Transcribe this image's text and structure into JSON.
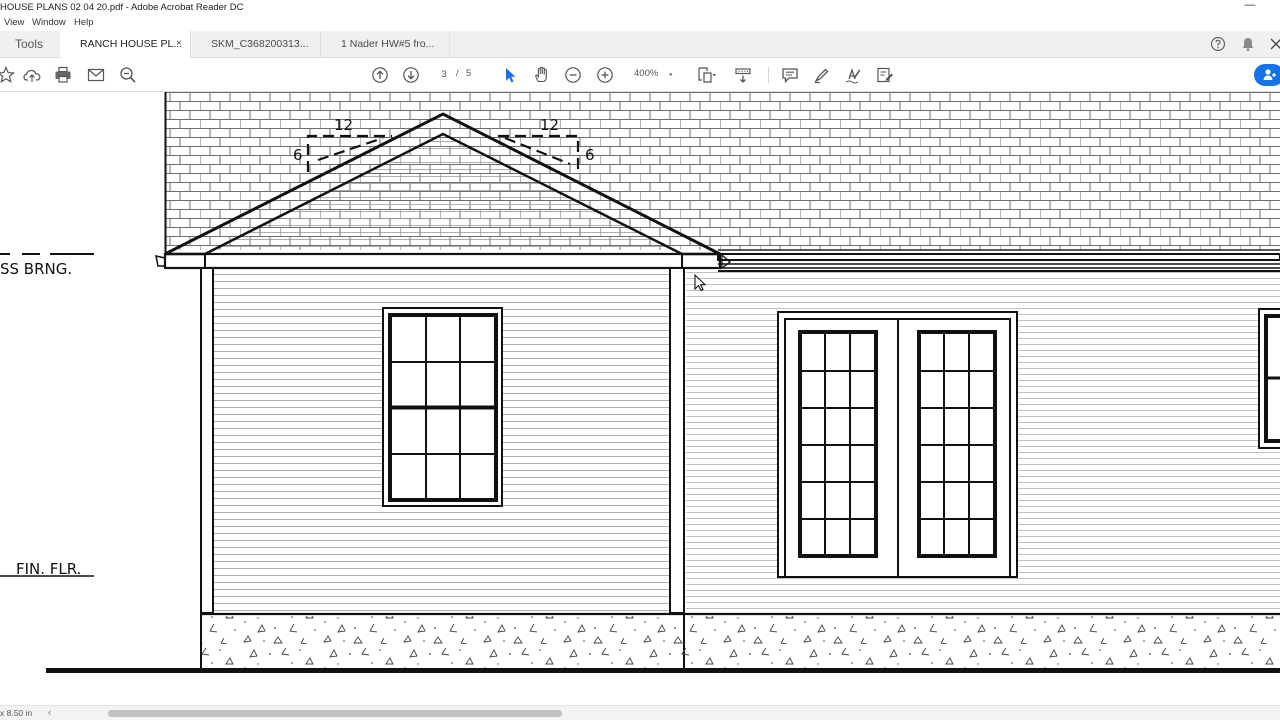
{
  "window": {
    "title": "HOUSE PLANS 02 04 20.pdf - Adobe Acrobat Reader DC",
    "minimize_glyph": "—"
  },
  "menu": {
    "items": [
      "View",
      "Window",
      "Help"
    ]
  },
  "tabs": {
    "tools": "Tools",
    "documents": [
      {
        "label": "RANCH HOUSE PL...",
        "active": true,
        "close": "×"
      },
      {
        "label": "SKM_C368200313...",
        "active": false
      },
      {
        "label": "1 Nader HW#5 fro...",
        "active": false
      }
    ]
  },
  "header_icons": [
    "help-icon",
    "bell-icon",
    "close-icon"
  ],
  "toolbar": {
    "page_current": "3",
    "page_separator": "/",
    "page_total": "5",
    "zoom": "400%",
    "left_icons": [
      "star-icon",
      "cloud-upload-icon",
      "print-icon",
      "email-icon",
      "search-zoom-icon"
    ],
    "nav_icons": [
      "previous-page-icon",
      "next-page-icon"
    ],
    "tool_icons": [
      "select-arrow-icon",
      "hand-icon",
      "zoom-out-icon",
      "zoom-in-icon"
    ],
    "right_icons": [
      "page-fit-icon",
      "scroll-mode-icon",
      "comment-icon",
      "highlight-icon",
      "sign-icon",
      "fill-sign-icon",
      "share-person-icon"
    ]
  },
  "drawing": {
    "labels": {
      "bearing": "SS BRNG.",
      "finish_floor": "FIN. FLR.",
      "pitch_left_run": "12",
      "pitch_left_rise": "6",
      "pitch_right_run": "12",
      "pitch_right_rise": "6"
    }
  },
  "status": {
    "page_size": "x 8.50 in"
  }
}
